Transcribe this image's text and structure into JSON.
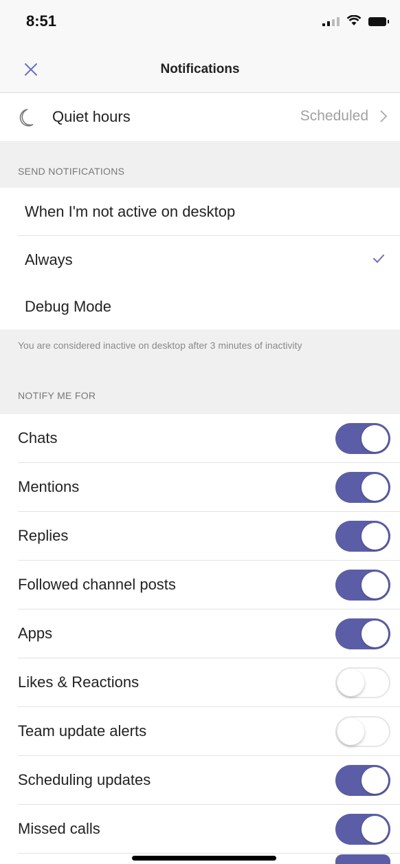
{
  "status_bar": {
    "time": "8:51"
  },
  "nav": {
    "title": "Notifications"
  },
  "quiet_hours": {
    "label": "Quiet hours",
    "value": "Scheduled"
  },
  "send_notifications": {
    "header": "SEND NOTIFICATIONS",
    "options": [
      {
        "label": "When I'm not active on desktop",
        "selected": false
      },
      {
        "label": "Always",
        "selected": true
      },
      {
        "label": "Debug Mode",
        "selected": false
      }
    ],
    "note": "You are considered inactive on desktop after 3 minutes of inactivity"
  },
  "notify_me_for": {
    "header": "NOTIFY ME FOR",
    "items": [
      {
        "label": "Chats",
        "enabled": true
      },
      {
        "label": "Mentions",
        "enabled": true
      },
      {
        "label": "Replies",
        "enabled": true
      },
      {
        "label": "Followed channel posts",
        "enabled": true
      },
      {
        "label": "Apps",
        "enabled": true
      },
      {
        "label": "Likes & Reactions",
        "enabled": false
      },
      {
        "label": "Team update alerts",
        "enabled": false
      },
      {
        "label": "Scheduling updates",
        "enabled": true
      },
      {
        "label": "Missed calls",
        "enabled": true
      }
    ]
  },
  "colors": {
    "accent": "#5b5ea6",
    "check": "#6b6fbf"
  }
}
